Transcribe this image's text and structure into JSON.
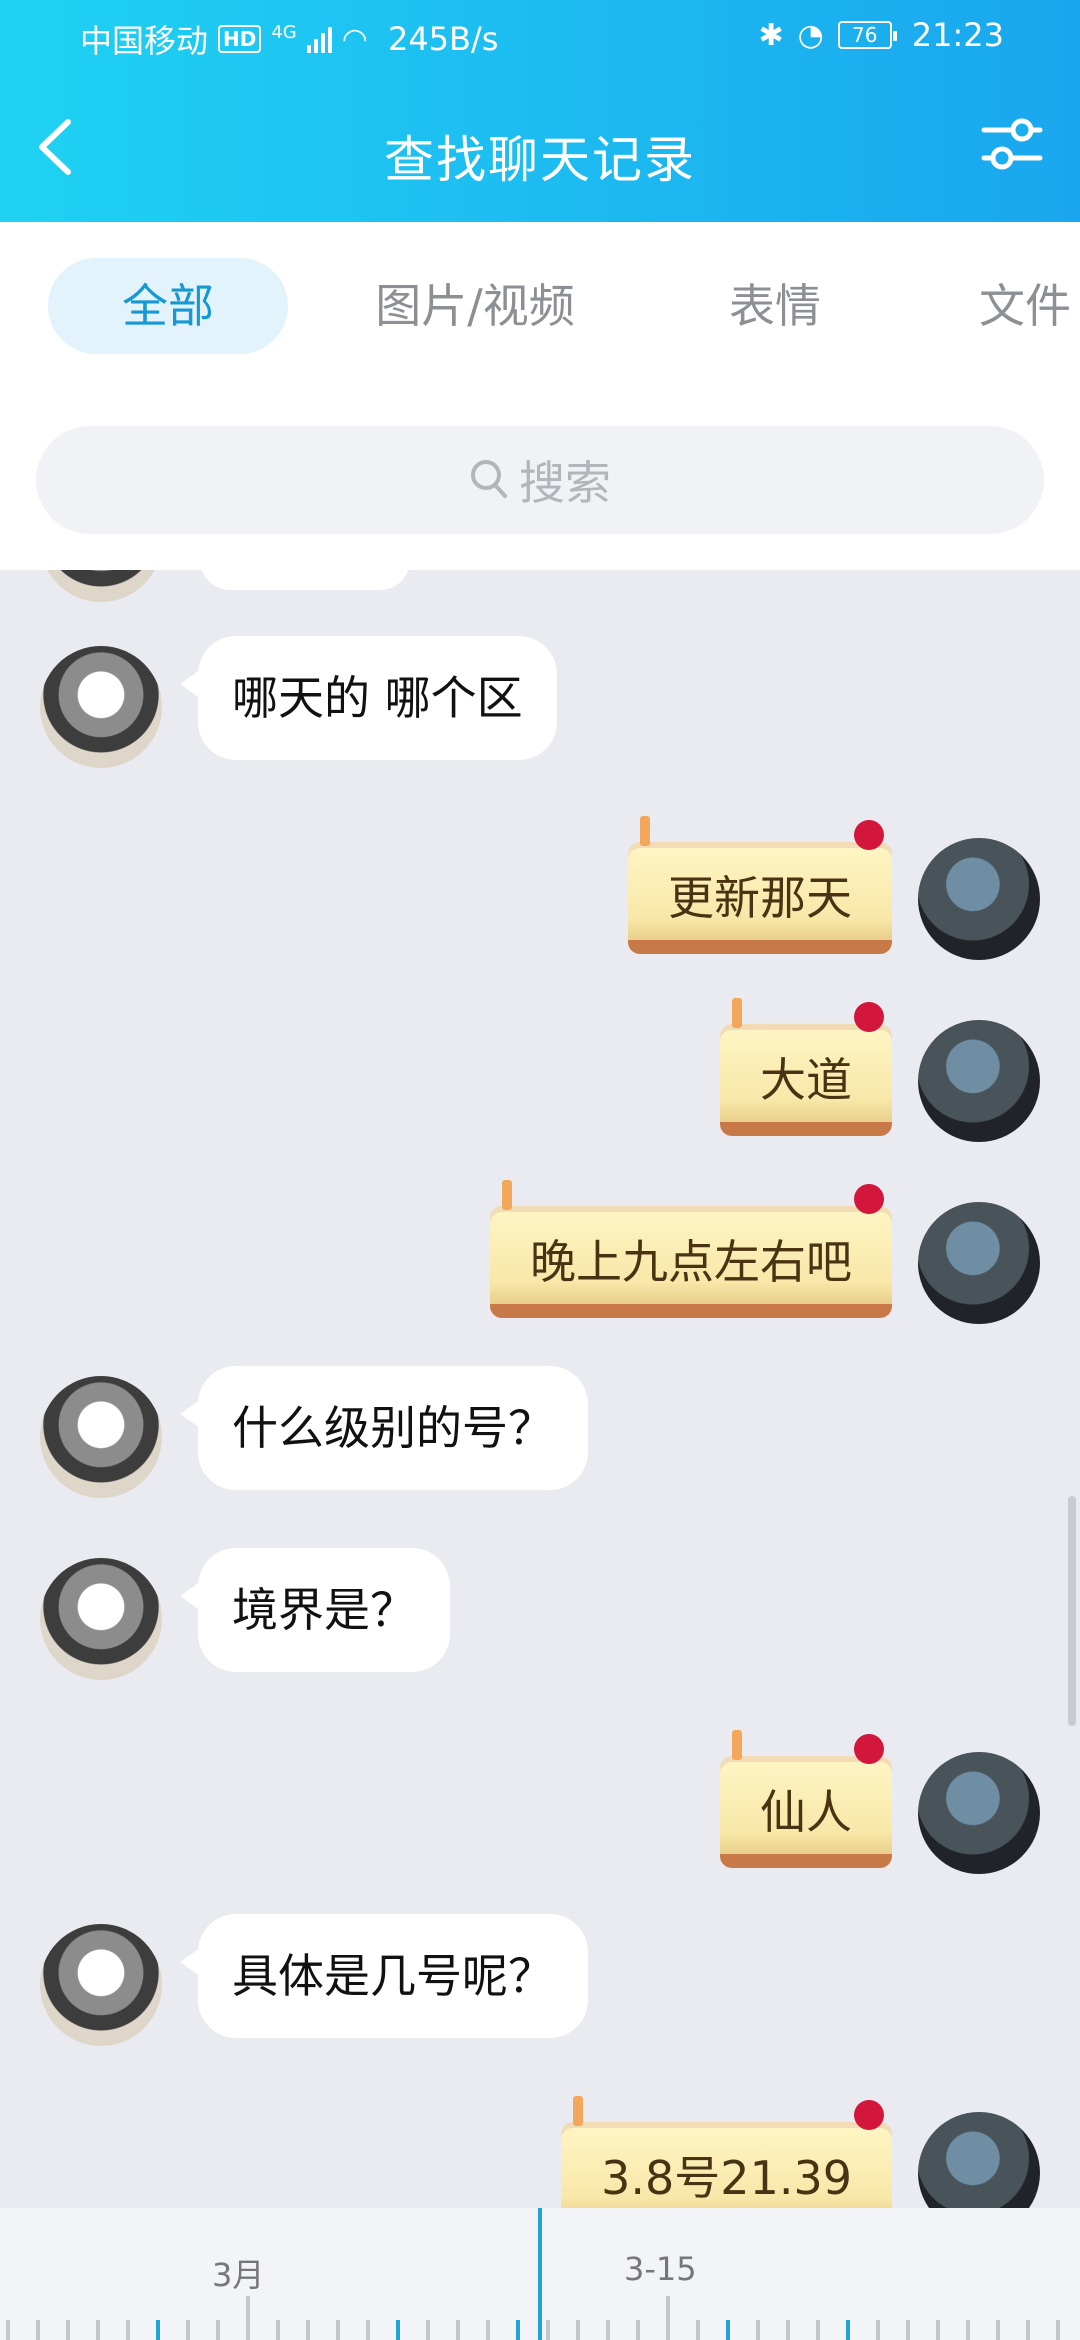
{
  "status_bar": {
    "carrier": "中国移动",
    "hd": "HD",
    "network": "4G",
    "speed": "245B/s",
    "battery": "76",
    "time": "21:23"
  },
  "header": {
    "title": "查找聊天记录"
  },
  "tabs": [
    {
      "label": "全部",
      "active": true
    },
    {
      "label": "图片/视频",
      "active": false
    },
    {
      "label": "表情",
      "active": false
    },
    {
      "label": "文件",
      "active": false
    }
  ],
  "search": {
    "placeholder": "搜索"
  },
  "messages": [
    {
      "side": "left",
      "text": "哪天的 哪个区"
    },
    {
      "side": "right",
      "text": "更新那天"
    },
    {
      "side": "right",
      "text": "大道"
    },
    {
      "side": "right",
      "text": "晚上九点左右吧"
    },
    {
      "side": "left",
      "text": "什么级别的号？"
    },
    {
      "side": "left",
      "text": "境界是？"
    },
    {
      "side": "right",
      "text": "仙人"
    },
    {
      "side": "left",
      "text": "具体是几号呢？"
    },
    {
      "side": "right",
      "text": "3.8号21.39"
    }
  ],
  "timeline": {
    "labels": [
      "3月",
      "3-15"
    ]
  },
  "colors": {
    "header_start": "#1fd2f3",
    "header_end": "#1aa6ee",
    "active_tab_bg": "#e3f3fc",
    "active_tab_text": "#1898d0",
    "chat_bg": "#e9ebf1",
    "timeline_accent": "#21a3d8"
  }
}
